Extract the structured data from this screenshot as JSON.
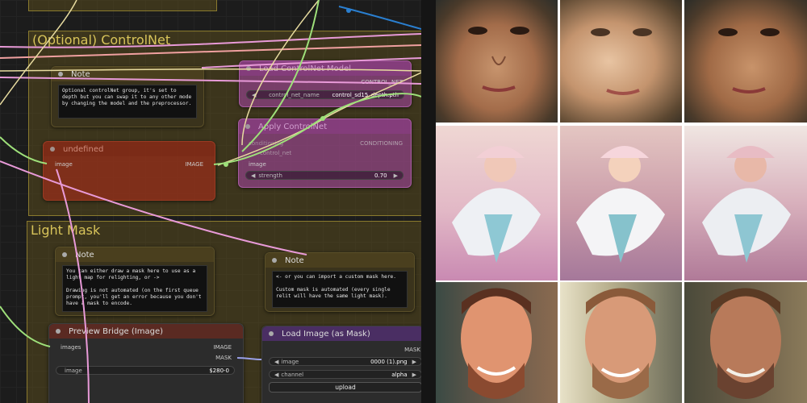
{
  "groups": {
    "controlnet_title": "(Optional) ControlNet",
    "lightmask_title": "Light Mask"
  },
  "note1": {
    "title": "Note",
    "text": "Optional controlNet group, it's set to depth but you can swap it to any other mode by changing the model and the preprocessor."
  },
  "controlnet_loader": {
    "title": "Load ControlNet Model",
    "output": "CONTROL_NET",
    "widget_label": "control_net_name",
    "widget_value": "control_sd15_depth.pth"
  },
  "apply_controlnet": {
    "title": "Apply ControlNet",
    "in1": "conditioning",
    "in2": "control_net",
    "in3": "image",
    "output": "CONDITIONING",
    "strength_label": "strength",
    "strength_value": "0.70"
  },
  "undefined_node": {
    "title": "undefined",
    "input": "image",
    "output": "IMAGE"
  },
  "note2": {
    "title": "Note",
    "text": "You can either draw a mask here to use as a light map for relighting, or ->\n\nDrawing is not automated (on the first queue prompt, you'll get an error because you don't have a mask to encode."
  },
  "note3": {
    "title": "Note",
    "text": "<- or you can import a custom mask here.\n\nCustom mask is automated (every single relit will have the same light mask)."
  },
  "preview_bridge": {
    "title": "Preview Bridge (Image)",
    "input": "images",
    "out1": "IMAGE",
    "out2": "MASK",
    "widget_label": "image",
    "widget_value": "$280-0"
  },
  "load_image_mask": {
    "title": "Load Image (as Mask)",
    "output": "MASK",
    "image_label": "image",
    "image_value": "0000 (1).png",
    "channel_label": "channel",
    "channel_value": "alpha",
    "upload_label": "upload"
  },
  "gallery": {
    "rows": [
      "portrait-woman-dark-hair",
      "woman-pink-dress-white-fan",
      "smiling-man-beard"
    ]
  },
  "colors": {
    "canvas_bg": "#1c1c1c",
    "group_gold": "#d8c45a",
    "controlnet_node": "#aa46aa",
    "undefined_node": "#962d19",
    "wire_green": "#9ee07a",
    "wire_pink": "#e89ad8",
    "wire_yellow": "#e8dca0",
    "wire_blue": "#2a7fd0"
  }
}
